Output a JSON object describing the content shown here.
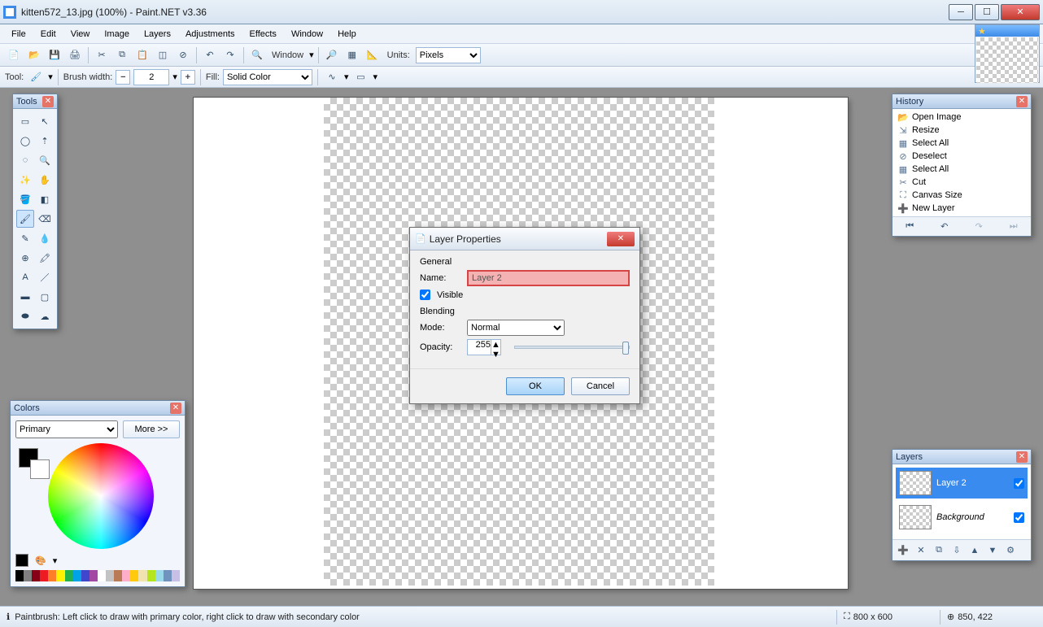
{
  "titlebar": {
    "title": "kitten572_13.jpg (100%) - Paint.NET v3.36"
  },
  "menu": [
    "File",
    "Edit",
    "View",
    "Image",
    "Layers",
    "Adjustments",
    "Effects",
    "Window",
    "Help"
  ],
  "toolbar1": {
    "window_label": "Window",
    "units_label": "Units:",
    "units_value": "Pixels"
  },
  "toolbar2": {
    "tool_label": "Tool:",
    "brush_label": "Brush width:",
    "brush_value": "2",
    "fill_label": "Fill:",
    "fill_value": "Solid Color"
  },
  "tools_panel": {
    "title": "Tools"
  },
  "colors_panel": {
    "title": "Colors",
    "scope": "Primary",
    "more": "More >>",
    "palette": [
      "#000",
      "#7f7f7f",
      "#880015",
      "#ed1c24",
      "#ff7f27",
      "#fff200",
      "#22b14c",
      "#00a2e8",
      "#3f48cc",
      "#a349a4",
      "#ffffff",
      "#c3c3c3",
      "#b97a57",
      "#ffaec9",
      "#ffc90e",
      "#efe4b0",
      "#b5e61d",
      "#99d9ea",
      "#7092be",
      "#c8bfe7"
    ]
  },
  "history_panel": {
    "title": "History",
    "items": [
      "Open Image",
      "Resize",
      "Select All",
      "Deselect",
      "Select All",
      "Cut",
      "Canvas Size",
      "New Layer"
    ]
  },
  "layers_panel": {
    "title": "Layers",
    "rows": [
      {
        "name": "Layer 2",
        "checked": true,
        "selected": true
      },
      {
        "name": "Background",
        "checked": true,
        "selected": false
      }
    ]
  },
  "dialog": {
    "title": "Layer Properties",
    "section_general": "General",
    "name_label": "Name:",
    "name_value": "Layer 2",
    "visible_label": "Visible",
    "visible_checked": true,
    "section_blend": "Blending",
    "mode_label": "Mode:",
    "mode_value": "Normal",
    "opacity_label": "Opacity:",
    "opacity_value": "255",
    "ok": "OK",
    "cancel": "Cancel"
  },
  "status": {
    "hint": "Paintbrush: Left click to draw with primary color, right click to draw with secondary color",
    "size": "800 x 600",
    "pos": "850, 422"
  }
}
